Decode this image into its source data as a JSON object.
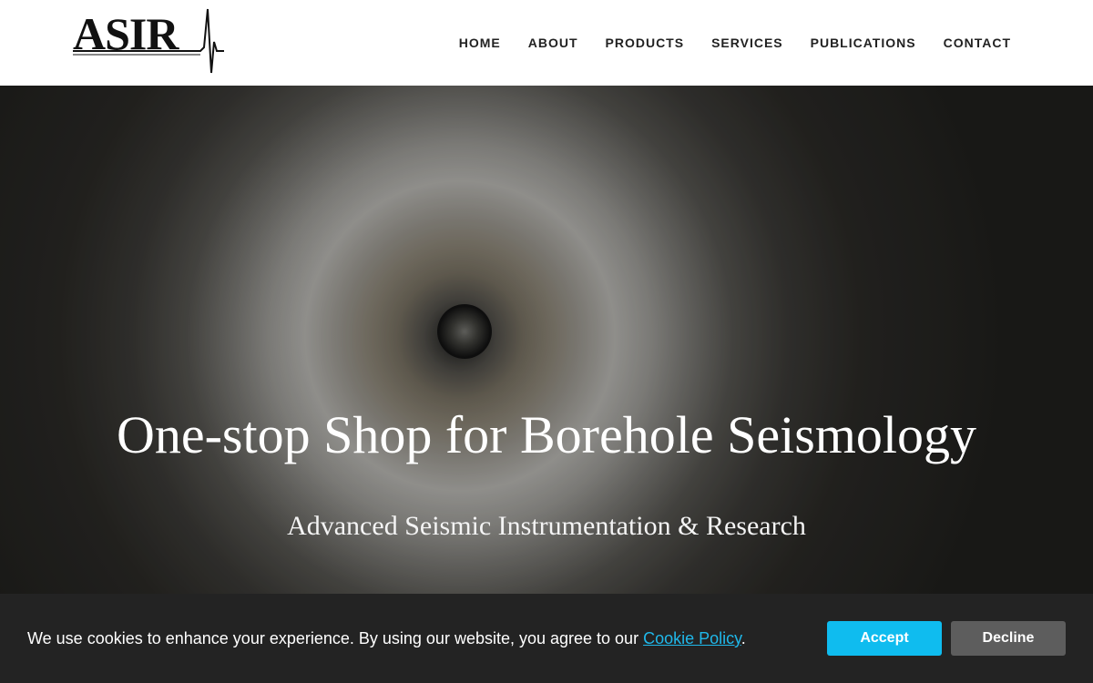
{
  "brand": {
    "logo_text": "ASIR"
  },
  "nav": {
    "items": [
      {
        "label": "HOME"
      },
      {
        "label": "ABOUT"
      },
      {
        "label": "PRODUCTS"
      },
      {
        "label": "SERVICES"
      },
      {
        "label": "PUBLICATIONS"
      },
      {
        "label": "CONTACT"
      }
    ]
  },
  "hero": {
    "title": "One-stop Shop for Borehole Seismology",
    "subtitle": "Advanced Seismic Instrumentation & Research"
  },
  "cookie": {
    "text_before": "We use cookies to enhance your experience. By using our website, you agree to our ",
    "link_label": "Cookie Policy",
    "text_after": ".",
    "accept_label": "Accept",
    "decline_label": "Decline"
  },
  "colors": {
    "accent": "#0fbcef",
    "link": "#1fb8ea",
    "cookie_bar": "#232323",
    "decline_button": "#5d5d5d"
  }
}
